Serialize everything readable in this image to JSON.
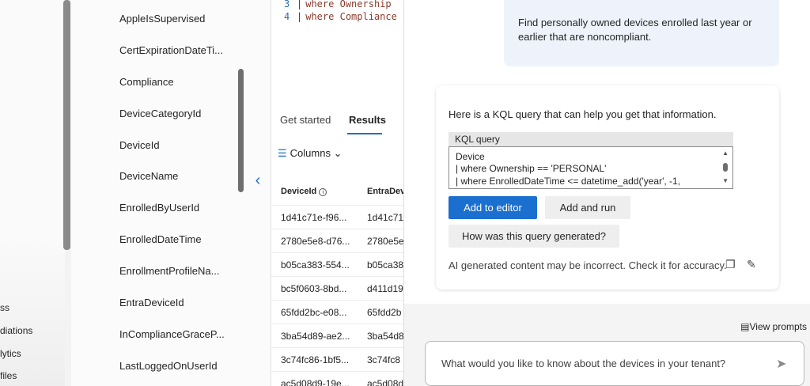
{
  "leftnav": {
    "items": [
      "ss",
      "diations",
      "lytics",
      "files"
    ]
  },
  "schema": {
    "fields": [
      "AppleIsSupervised",
      "CertExpirationDateTi...",
      "Compliance",
      "DeviceCategoryId",
      "DeviceId",
      "DeviceName",
      "EnrolledByUserId",
      "EnrolledDateTime",
      "EnrollmentProfileNa...",
      "EntraDeviceId",
      "InComplianceGraceP...",
      "LastLoggedOnUserId"
    ]
  },
  "editor": {
    "lines": [
      {
        "num": "3",
        "keyword": "where",
        "text": "Ownership"
      },
      {
        "num": "4",
        "keyword": "where",
        "text": "Compliance"
      }
    ]
  },
  "results": {
    "tabs": [
      "Get started",
      "Results"
    ],
    "columns_label": "Columns",
    "headers": [
      "DeviceId",
      "EntraDev"
    ],
    "rows": [
      [
        "1d41c71e-f96...",
        "1d41c71"
      ],
      [
        "2780e5e8-d76...",
        "2780e5e"
      ],
      [
        "b05ca383-554...",
        "b05ca38"
      ],
      [
        "bc5f0603-8bd...",
        "d411d19"
      ],
      [
        "65fdd2bc-e08...",
        "65fdd2b"
      ],
      [
        "3ba54d89-ae2...",
        "3ba54d8"
      ],
      [
        "3c74fc86-1bf5...",
        "3c74fc8"
      ],
      [
        "ac5d08d9-19e...",
        "ac5d08d"
      ]
    ]
  },
  "copilot": {
    "user_message": "Find personally owned devices enrolled last year or earlier that are noncompliant.",
    "ai_intro": "Here is a KQL query that can help you get that information.",
    "kql_label": "KQL query",
    "kql_lines": [
      "Device",
      "| where Ownership == 'PERSONAL'",
      "| where EnrolledDateTime <= datetime_add('year', -1,"
    ],
    "add_to_editor": "Add to editor",
    "add_and_run": "Add and run",
    "how_generated": "How was this query generated?",
    "disclaimer": "AI generated content may be incorrect. Check it for accuracy.",
    "view_prompts": "View prompts",
    "prompt_placeholder": "What would you like to know about the devices in your tenant?"
  },
  "colors": {
    "accent": "#1a6fcf",
    "user_bubble": "#eef3fb"
  }
}
